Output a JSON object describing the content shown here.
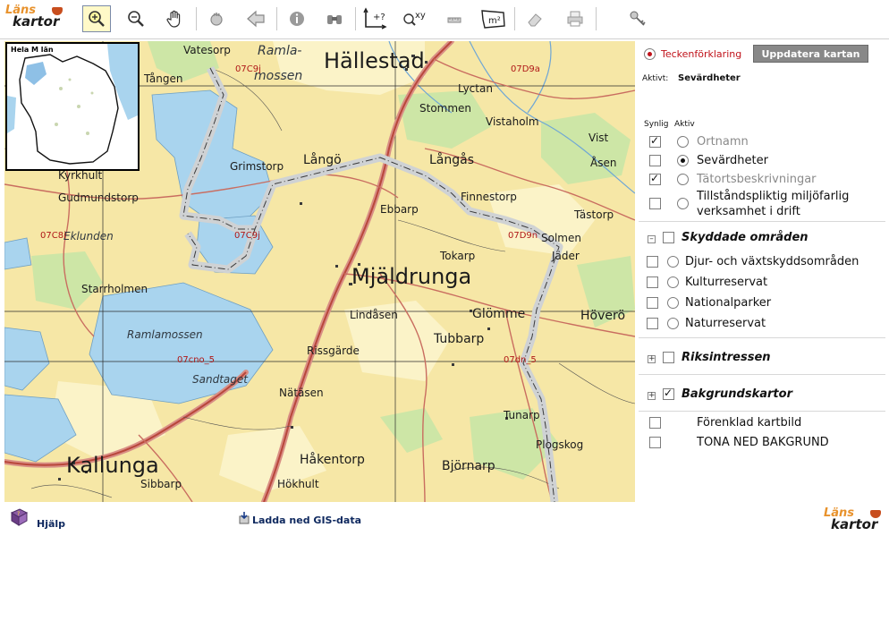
{
  "logo": {
    "line1": "Läns",
    "line2": "kartor"
  },
  "toolbar": {
    "buttons": [
      {
        "name": "zoom-in-tool",
        "label": ""
      },
      {
        "name": "zoom-out-tool",
        "label": ""
      },
      {
        "name": "pan-tool",
        "label": ""
      },
      {
        "name": "full-extent-tool",
        "label": ""
      },
      {
        "name": "back-tool",
        "label": ""
      },
      {
        "name": "info-tool",
        "label": ""
      },
      {
        "name": "search-tool",
        "label": ""
      },
      {
        "name": "coordinate-tool",
        "label": ""
      },
      {
        "name": "xy-zoom-tool",
        "label": ""
      },
      {
        "name": "measure-line-tool",
        "label": ""
      },
      {
        "name": "measure-area-tool",
        "label": "m²"
      },
      {
        "name": "eraser-tool",
        "label": ""
      },
      {
        "name": "print-tool",
        "label": ""
      },
      {
        "name": "key-tool",
        "label": ""
      }
    ]
  },
  "overview": {
    "title": "Hela M län"
  },
  "map": {
    "places": [
      {
        "text": "Hällestad",
        "cls": "big"
      },
      {
        "text": "Mjäldrunga",
        "cls": "big"
      },
      {
        "text": "Kallunga",
        "cls": "big"
      },
      {
        "text": "Ramla-",
        "cls": "med it"
      },
      {
        "text": "mossen",
        "cls": "med it"
      },
      {
        "text": "Ramlamossen",
        "cls": "sm it"
      },
      {
        "text": "Vatesorp",
        "cls": "sm"
      },
      {
        "text": "Tången",
        "cls": "sm"
      },
      {
        "text": "Grimstorp",
        "cls": "sm"
      },
      {
        "text": "Långö",
        "cls": "med"
      },
      {
        "text": "Ebbarp",
        "cls": "sm"
      },
      {
        "text": "Stommen",
        "cls": "sm"
      },
      {
        "text": "Lyctan",
        "cls": "sm"
      },
      {
        "text": "Vistaholm",
        "cls": "sm"
      },
      {
        "text": "Vist",
        "cls": "sm"
      },
      {
        "text": "Åsen",
        "cls": "sm"
      },
      {
        "text": "Långås",
        "cls": "med"
      },
      {
        "text": "Finnestorp",
        "cls": "sm"
      },
      {
        "text": "Tästorp",
        "cls": "sm"
      },
      {
        "text": "Kyrkhult",
        "cls": "sm"
      },
      {
        "text": "Gudmundstorp",
        "cls": "sm"
      },
      {
        "text": "Eklunden",
        "cls": "sm it"
      },
      {
        "text": "Starrholmen",
        "cls": "sm"
      },
      {
        "text": "Tokarp",
        "cls": "sm"
      },
      {
        "text": "Jäder",
        "cls": "sm"
      },
      {
        "text": "Solmen",
        "cls": "sm"
      },
      {
        "text": "Lindåsen",
        "cls": "sm"
      },
      {
        "text": "Glömme",
        "cls": "med"
      },
      {
        "text": "Höverö",
        "cls": "med"
      },
      {
        "text": "Tubbarp",
        "cls": "med"
      },
      {
        "text": "Rissgärde",
        "cls": "sm"
      },
      {
        "text": "Sandtaget",
        "cls": "sm it"
      },
      {
        "text": "Nätäsen",
        "cls": "sm"
      },
      {
        "text": "Tunarp",
        "cls": "sm"
      },
      {
        "text": "Plogskog",
        "cls": "sm"
      },
      {
        "text": "Håkentorp",
        "cls": "med"
      },
      {
        "text": "Björnarp",
        "cls": "med"
      },
      {
        "text": "Sibbarp",
        "cls": "sm"
      },
      {
        "text": "Hökhult",
        "cls": "sm"
      }
    ],
    "grid_labels": [
      "07C9j",
      "07D9a",
      "07C9j",
      "07C8i",
      "07D9n",
      "07cno_5",
      "07dn_5"
    ]
  },
  "legend": {
    "teckenforklaring_label": "Teckenförklaring",
    "update_button": "Uppdatera kartan",
    "active_prefix": "Aktivt:",
    "active_value": "Sevärdheter",
    "col_synlig": "Synlig",
    "col_aktiv": "Aktiv",
    "top_layers": [
      {
        "label": "Ortnamn",
        "visible": true,
        "active": false,
        "grey": true
      },
      {
        "label": "Sevärdheter",
        "visible": false,
        "active": true,
        "grey": false
      },
      {
        "label": "Tätortsbeskrivningar",
        "visible": true,
        "active": false,
        "grey": true
      },
      {
        "label": "Tillståndspliktig miljöfarlig",
        "label2": "verksamhet i drift",
        "visible": false,
        "active": false,
        "grey": false
      }
    ],
    "groups": {
      "skyddade": {
        "title": "Skyddade områden",
        "expander": "–",
        "items": [
          "Djur- och växtskyddsområden",
          "Kulturreservat",
          "Nationalparker",
          "Naturreservat"
        ]
      },
      "riks": {
        "title": "Riksintressen",
        "expander": "+"
      },
      "bakgrund": {
        "title": "Bakgrundskartor",
        "expander": "+",
        "items": [
          "Förenklad kartbild",
          "TONA NED BAKGRUND"
        ]
      }
    }
  },
  "footer": {
    "help": "Hjälp",
    "download": "Ladda ned GIS-data"
  }
}
